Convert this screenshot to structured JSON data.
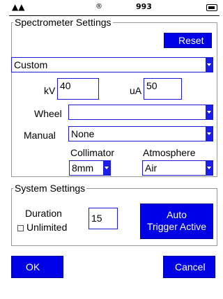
{
  "status_bar": {
    "signal_glyph": "▲▲",
    "registered_mark": "®",
    "number": "993",
    "battery_icon": "battery-icon"
  },
  "spectrometer": {
    "legend": "Spectrometer Settings",
    "reset_label": "Reset",
    "mode_value": "Custom",
    "kv_label": "kV",
    "kv_value": "40",
    "ua_label": "uA",
    "ua_value": "50",
    "wheel_label": "Wheel",
    "wheel_value": "",
    "manual_label": "Manual",
    "manual_value": "None",
    "collimator_label": "Collimator",
    "collimator_value": "8mm",
    "atmosphere_label": "Atmosphere",
    "atmosphere_value": "Air"
  },
  "system": {
    "legend": "System Settings",
    "duration_label": "Duration",
    "duration_value": "15",
    "unlimited_label": "Unlimited",
    "unlimited_checked": false,
    "trigger_line1": "Auto",
    "trigger_line2": "Trigger Active"
  },
  "footer": {
    "ok_label": "OK",
    "cancel_label": "Cancel"
  },
  "colors": {
    "accent": "#0000e6",
    "border": "#9a9a9a"
  }
}
